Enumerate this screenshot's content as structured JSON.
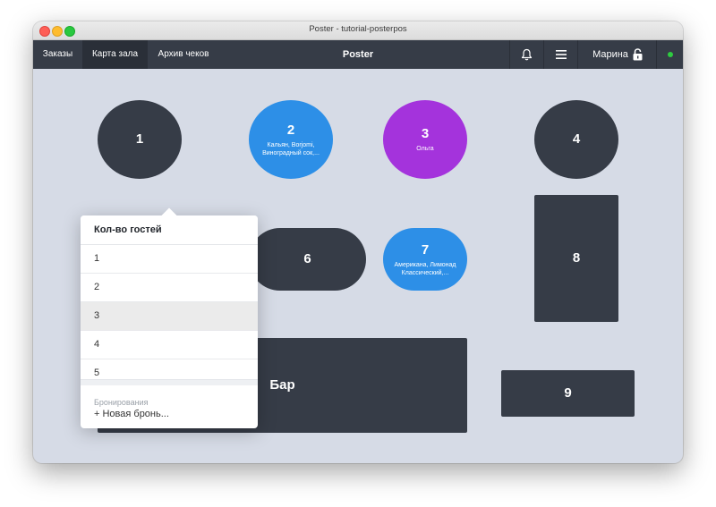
{
  "window": {
    "title": "Poster - tutorial-posterpos"
  },
  "topbar": {
    "tabs": [
      {
        "label": "Заказы"
      },
      {
        "label": "Карта зала",
        "active": true
      },
      {
        "label": "Архив чеков"
      }
    ],
    "app_title": "Poster",
    "icons": [
      "bell-icon",
      "menu-icon",
      "lock-icon"
    ],
    "user_name": "Марина",
    "status_color": "#2ecc40"
  },
  "colors": {
    "table_dark": "#363c47",
    "table_blue": "#2d8fe7",
    "table_purple": "#a433dc",
    "floor": "#d6dbe6"
  },
  "tables": [
    {
      "number": "1",
      "guests": ""
    },
    {
      "number": "2",
      "guests": "Кальян, Borjomi, Виноградный сок,..."
    },
    {
      "number": "3",
      "guests": "Ольга"
    },
    {
      "number": "4",
      "guests": ""
    },
    {
      "number": "6",
      "guests": ""
    },
    {
      "number": "7",
      "guests": "Американа, Лимонад Классический,..."
    },
    {
      "number": "8",
      "guests": ""
    },
    {
      "number": "Бар",
      "guests": ""
    },
    {
      "number": "9",
      "guests": ""
    }
  ],
  "popup": {
    "header": "Кол-во гостей",
    "options": [
      "1",
      "2",
      "3",
      "4",
      "5"
    ],
    "selected": "3",
    "bookings_label": "Бронирования",
    "new_booking": "+ Новая бронь..."
  }
}
